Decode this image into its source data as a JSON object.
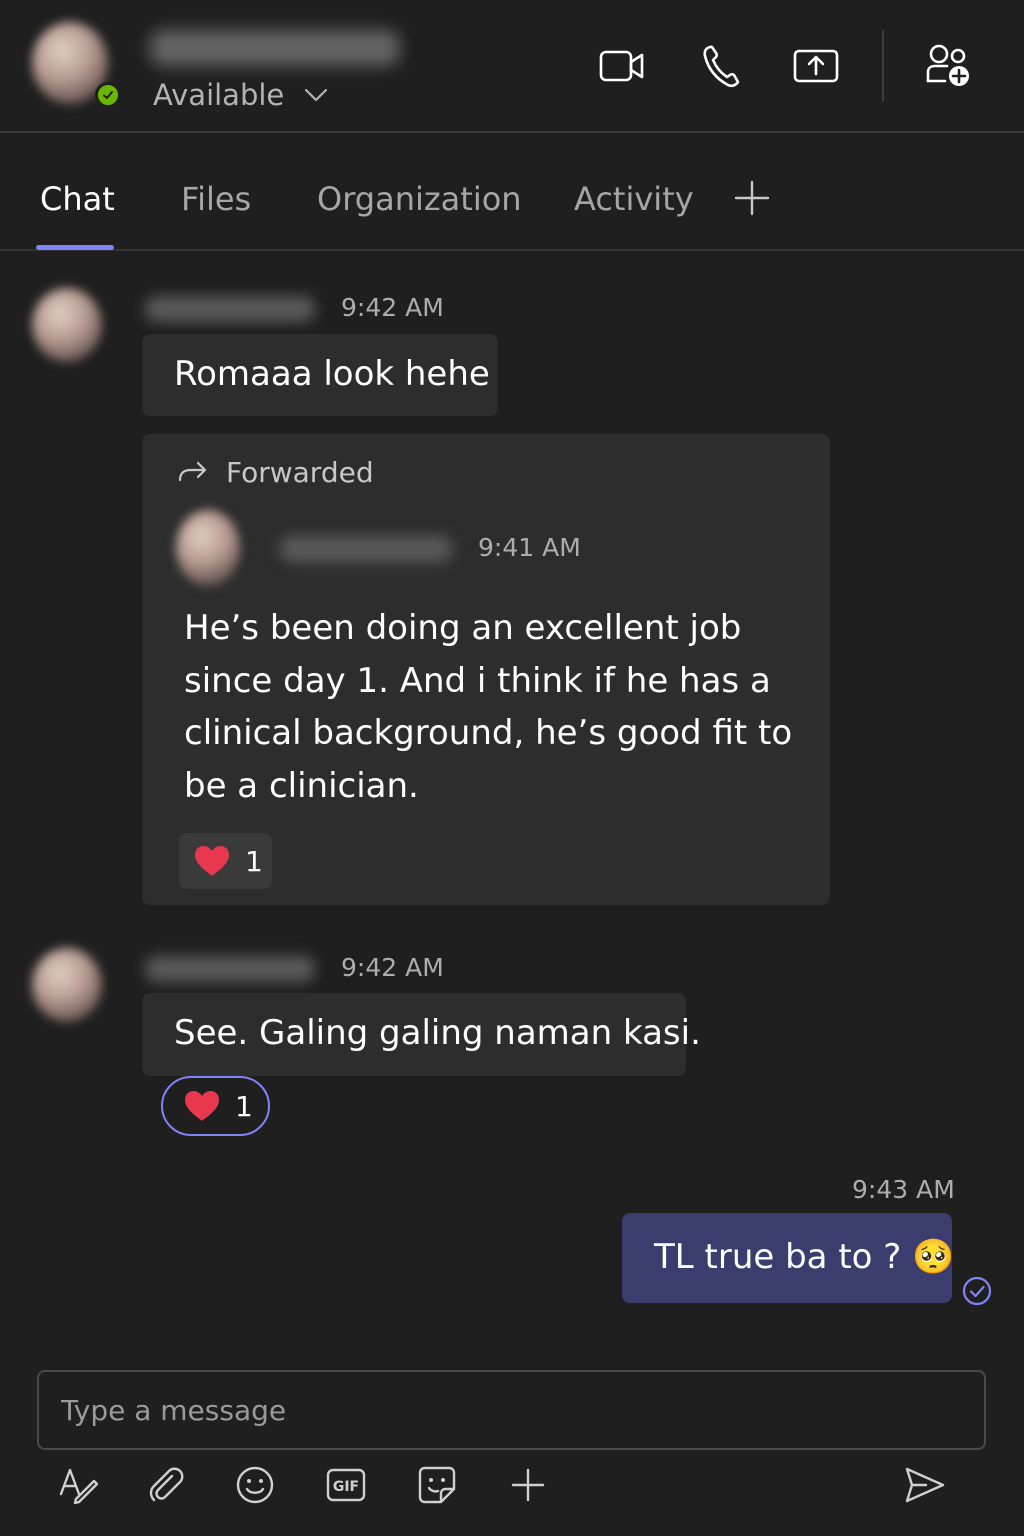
{
  "header": {
    "status": "Available",
    "icons": [
      "video-call-icon",
      "phone-call-icon",
      "share-screen-icon",
      "add-people-icon"
    ]
  },
  "tabs": [
    {
      "label": "Chat",
      "active": true
    },
    {
      "label": "Files",
      "active": false
    },
    {
      "label": "Organization",
      "active": false
    },
    {
      "label": "Activity",
      "active": false
    }
  ],
  "messages": {
    "m1": {
      "time": "9:42 AM",
      "text": "Romaaa look hehe"
    },
    "forwarded": {
      "label": "Forwarded",
      "time": "9:41 AM",
      "text": "He’s been doing an excellent job since day 1. And i think if he has a clinical background, he’s good fit to be a clinician.",
      "reaction_count": "1"
    },
    "m2": {
      "time": "9:42 AM",
      "text": "See. Galing galing naman kasi.",
      "reaction_count": "1"
    },
    "mine": {
      "time": "9:43 AM",
      "text": "TL true ba to ? ",
      "emoji": "🥺"
    }
  },
  "compose": {
    "placeholder": "Type a message",
    "toolbar_icons": [
      "format-icon",
      "attach-icon",
      "emoji-icon",
      "gif-icon",
      "sticker-icon",
      "add-icon",
      "send-icon"
    ],
    "gif_label": "GIF"
  },
  "colors": {
    "background": "#1f1f1f",
    "bubble": "#2d2d2d",
    "my_bubble": "#3a3d6e",
    "accent": "#7f85f5",
    "presence": "#6bb700",
    "heart": "#e8384f"
  }
}
